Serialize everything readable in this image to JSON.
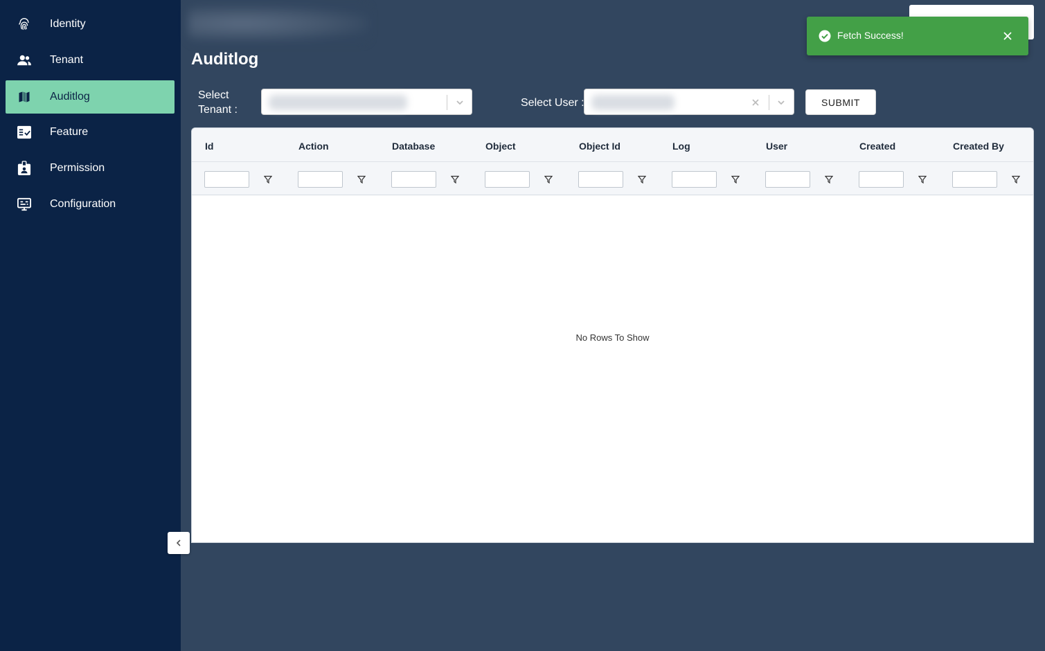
{
  "sidebar": {
    "items": [
      {
        "label": "Identity",
        "icon": "fingerprint-icon",
        "active": false
      },
      {
        "label": "Tenant",
        "icon": "people-icon",
        "active": false
      },
      {
        "label": "Auditlog",
        "icon": "map-icon",
        "active": true
      },
      {
        "label": "Feature",
        "icon": "checklist-icon",
        "active": false
      },
      {
        "label": "Permission",
        "icon": "badge-icon",
        "active": false
      },
      {
        "label": "Configuration",
        "icon": "settings-panel-icon",
        "active": false
      }
    ]
  },
  "page": {
    "title": "Auditlog"
  },
  "filters": {
    "tenant_label_line1": "Select",
    "tenant_label_line2": "Tenant :",
    "user_label": "Select User :",
    "submit_label": "SUBMIT"
  },
  "grid": {
    "columns": [
      "Id",
      "Action",
      "Database",
      "Object",
      "Object Id",
      "Log",
      "User",
      "Created",
      "Created By"
    ],
    "empty_message": "No Rows To Show"
  },
  "toast": {
    "message": "Fetch Success!",
    "type": "success",
    "color": "#43a047"
  },
  "colors": {
    "sidebar": "#0b2346",
    "active_item": "#7ed3ae",
    "background": "#32465f"
  }
}
